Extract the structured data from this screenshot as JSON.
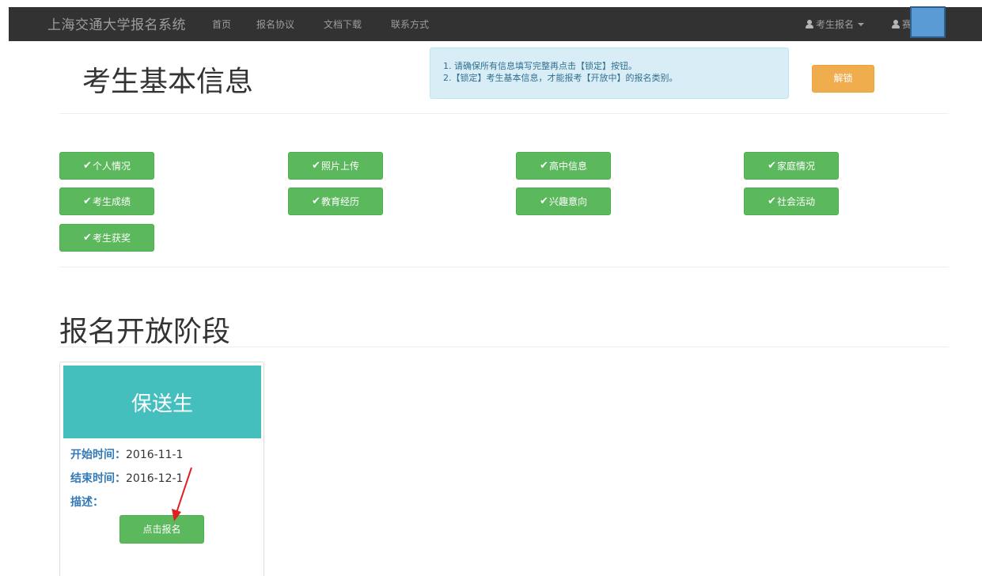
{
  "navbar": {
    "brand": "上海交通大学报名系统",
    "links": [
      "首页",
      "报名协议",
      "文档下载",
      "联系方式"
    ],
    "user_menu_label": "考生报名",
    "user_name_partial": "赛",
    "icon": "user-icon"
  },
  "page_title": "考生基本信息",
  "alert": {
    "line1": "1. 请确保所有信息填写完整再点击【锁定】按钮。",
    "line2": "2.【锁定】考生基本信息，才能报考【开放中】的报名类别。"
  },
  "unlock_button": "解锁",
  "check_glyph": "✔",
  "sections": [
    "个人情况",
    "照片上传",
    "高中信息",
    "家庭情况",
    "考生成绩",
    "教育经历",
    "兴趣意向",
    "社会活动",
    "考生获奖"
  ],
  "open_stage": {
    "heading": "报名开放阶段",
    "card": {
      "title": "保送生",
      "start_label": "开始时间：",
      "start_value": "2016-11-1",
      "end_label": "结束时间：",
      "end_value": "2016-12-1",
      "desc_label": "描述：",
      "desc_value": "",
      "button": "点击报名"
    }
  },
  "colors": {
    "navbar": "#333232",
    "success": "#5cb85c",
    "warning": "#f0ad4e",
    "info_bg": "#d9edf7",
    "card_head": "#45bfbe",
    "label": "#337ab7",
    "arrow": "#e02020"
  }
}
